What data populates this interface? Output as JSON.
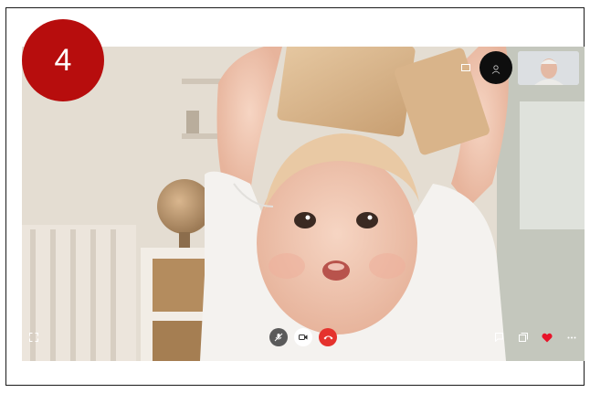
{
  "step": {
    "number": "4"
  },
  "call": {
    "controls": {
      "mute": "microphone-muted-icon",
      "camera": "video-camera-icon",
      "end_call": "phone-hangup-icon",
      "chat": "chat-icon",
      "participants": "people-icon",
      "reaction": "heart-icon",
      "more": "more-icon",
      "fullscreen": "fullscreen-icon",
      "pip_toggle": "minimize-icon"
    },
    "colors": {
      "end_call": "#e5322d",
      "camera_button": "#ffffff",
      "mute_button": "#5a5a5a",
      "heart": "#e8142a",
      "avatar_bg": "#0e0e0e"
    }
  },
  "colors": {
    "step_badge": "#b70d0d"
  }
}
